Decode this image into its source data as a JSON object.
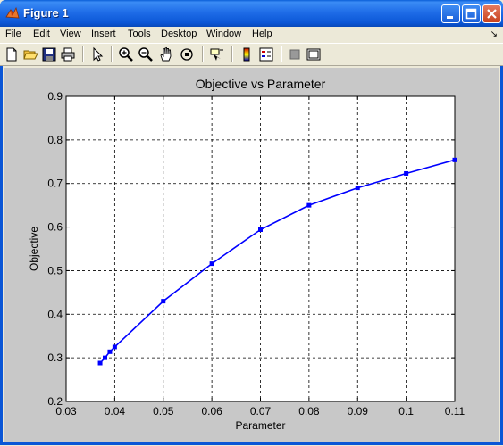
{
  "window": {
    "title": "Figure 1",
    "icon": "matlab-icon",
    "controls": [
      "minimize-icon",
      "maximize-icon",
      "close-icon"
    ]
  },
  "menu": {
    "items": [
      "File",
      "Edit",
      "View",
      "Insert",
      "Tools",
      "Desktop",
      "Window",
      "Help"
    ]
  },
  "toolbar": {
    "buttons": [
      "new-figure-icon",
      "open-icon",
      "save-icon",
      "print-icon",
      "pointer-icon",
      "zoom-in-icon",
      "zoom-out-icon",
      "pan-icon",
      "rotate-3d-icon",
      "data-cursor-icon",
      "insert-colorbar-icon",
      "insert-legend-icon",
      "hide-plot-tools-icon",
      "show-plot-tools-icon"
    ]
  },
  "colors": {
    "series": "#0000ff",
    "axes_bg": "#ffffff",
    "figure_bg": "#c8c8c8"
  },
  "chart_data": {
    "type": "line",
    "title": "Objective vs Parameter",
    "xlabel": "Parameter",
    "ylabel": "Objective",
    "xlim": [
      0.03,
      0.11
    ],
    "ylim": [
      0.2,
      0.9
    ],
    "xticks": [
      0.03,
      0.04,
      0.05,
      0.06,
      0.07,
      0.08,
      0.09,
      0.1,
      0.11
    ],
    "xtick_labels": [
      "0.03",
      "0.04",
      "0.05",
      "0.06",
      "0.07",
      "0.08",
      "0.09",
      "0.1",
      "0.11"
    ],
    "yticks": [
      0.2,
      0.3,
      0.4,
      0.5,
      0.6,
      0.7,
      0.8,
      0.9
    ],
    "ytick_labels": [
      "0.2",
      "0.3",
      "0.4",
      "0.5",
      "0.6",
      "0.7",
      "0.8",
      "0.9"
    ],
    "grid": true,
    "grid_style": "dashed",
    "series": [
      {
        "marker": "square",
        "x": [
          0.037,
          0.038,
          0.039,
          0.04,
          0.05,
          0.06,
          0.07,
          0.08,
          0.09,
          0.1,
          0.11
        ],
        "y": [
          0.288,
          0.3,
          0.314,
          0.325,
          0.43,
          0.516,
          0.594,
          0.65,
          0.69,
          0.723,
          0.754
        ]
      }
    ]
  }
}
